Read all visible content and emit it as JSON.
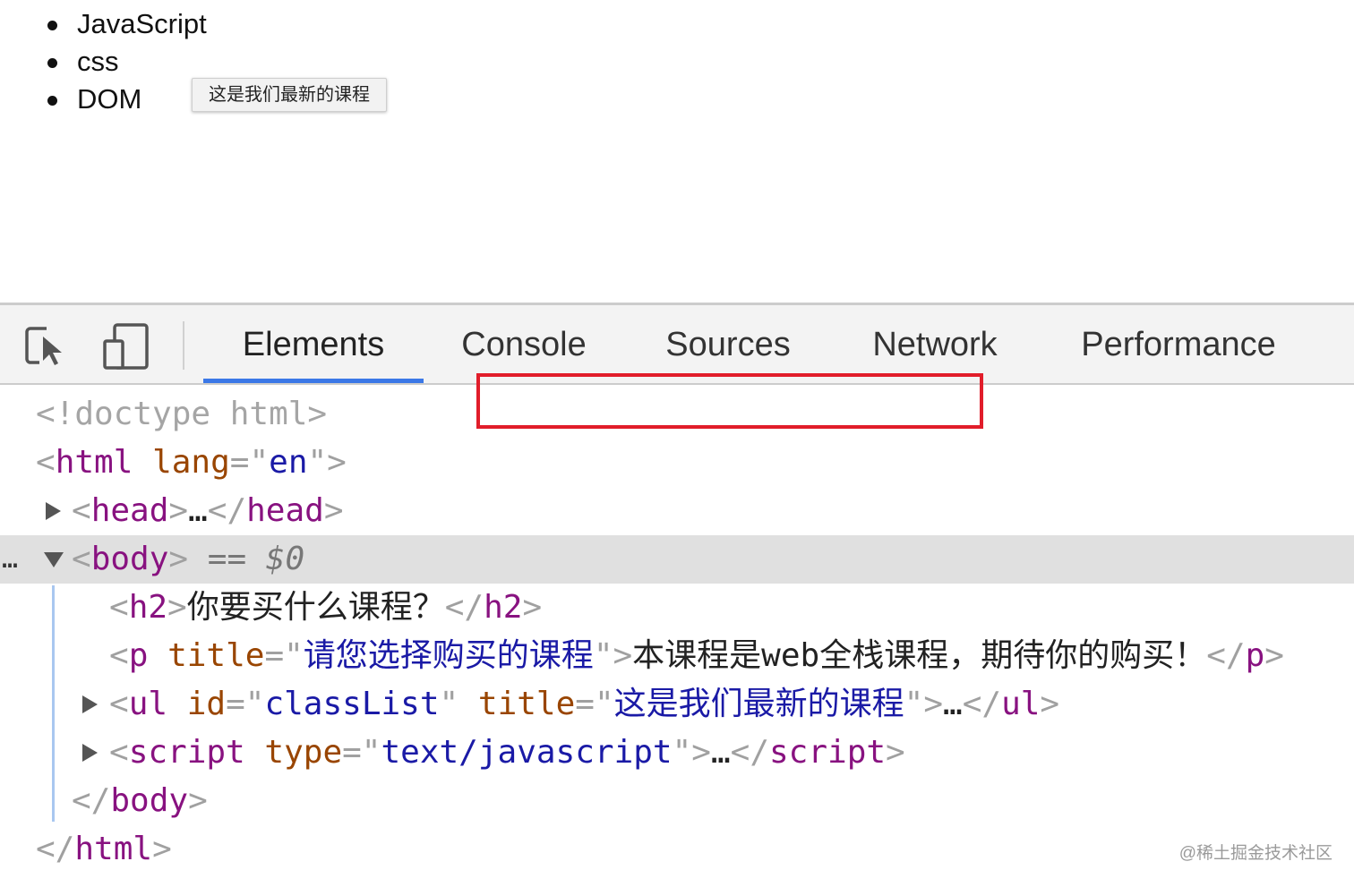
{
  "preview": {
    "list_items": [
      "JavaScript",
      "css",
      "DOM"
    ],
    "tooltip": "这是我们最新的课程"
  },
  "devtools": {
    "toolbar": {
      "inspect_icon": "element-picker-icon",
      "device_icon": "device-toolbar-icon",
      "tabs": [
        "Elements",
        "Console",
        "Sources",
        "Network",
        "Performance"
      ],
      "active_tab": "Elements",
      "accent_color": "#3b78e7"
    },
    "tree": {
      "doctype": "<!doctype html>",
      "html_open": {
        "tag": "html",
        "attr": "lang",
        "value": "en"
      },
      "head": {
        "tag": "head",
        "collapsed": "…"
      },
      "body": {
        "tag": "body",
        "marker": "== $0",
        "ellipsis": "…"
      },
      "h2": {
        "tag": "h2",
        "text": "你要买什么课程？"
      },
      "p": {
        "tag": "p",
        "attr": "title",
        "value": "请您选择购买的课程",
        "text": "本课程是web全栈课程，期待你的购买！"
      },
      "ul": {
        "tag": "ul",
        "attr1": "id",
        "value1": "classList",
        "attr2": "title",
        "value2": "这是我们最新的课程",
        "collapsed": "…"
      },
      "script": {
        "tag": "script",
        "attr": "type",
        "value": "text/javascript",
        "collapsed": "…"
      },
      "body_close": "body",
      "html_close": "html"
    },
    "highlight_color": "#e11d2a"
  },
  "watermark": "@稀土掘金技术社区"
}
